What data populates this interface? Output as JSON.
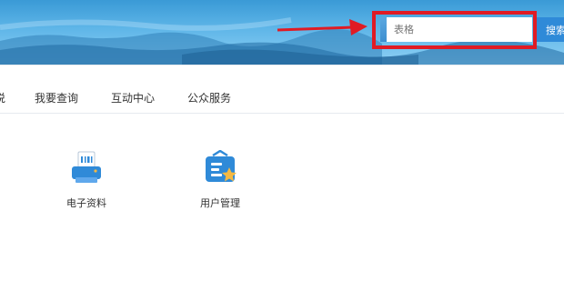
{
  "header": {
    "search_placeholder": "表格",
    "search_button_label": "搜索"
  },
  "nav": {
    "items": [
      {
        "label": "说"
      },
      {
        "label": "我要查询"
      },
      {
        "label": "互动中心"
      },
      {
        "label": "公众服务"
      }
    ]
  },
  "tiles": [
    {
      "label": "电子资料",
      "icon": "printer-document-icon"
    },
    {
      "label": "用户管理",
      "icon": "user-card-star-icon"
    }
  ],
  "colors": {
    "highlight": "#e01b24",
    "accent": "#2f8ad8",
    "banner": "#5fb6e8"
  }
}
